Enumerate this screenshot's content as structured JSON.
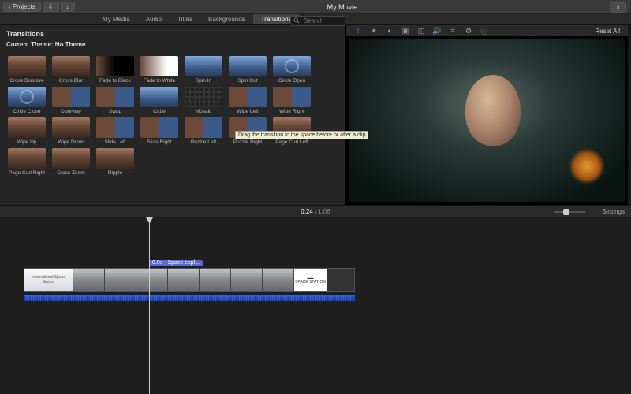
{
  "titlebar": {
    "back": "Projects",
    "title": "My Movie"
  },
  "tabs": [
    "My Media",
    "Audio",
    "Titles",
    "Backgrounds",
    "Transitions"
  ],
  "tabs_active": "Transitions",
  "search": {
    "placeholder": "Search"
  },
  "browser": {
    "heading": "Transitions",
    "theme": "Current Theme: No Theme",
    "items": [
      {
        "label": "Cross Dissolve",
        "cls": ""
      },
      {
        "label": "Cross Blur",
        "cls": ""
      },
      {
        "label": "Fade to Black",
        "cls": "black"
      },
      {
        "label": "Fade to White",
        "cls": "white"
      },
      {
        "label": "Spin In",
        "cls": "blue"
      },
      {
        "label": "Spin Out",
        "cls": "blue"
      },
      {
        "label": "Circle Open",
        "cls": "blue circle"
      },
      {
        "label": "Circle Close",
        "cls": "blue circle"
      },
      {
        "label": "Doorway",
        "cls": "split"
      },
      {
        "label": "Swap",
        "cls": "split"
      },
      {
        "label": "Cube",
        "cls": "blue"
      },
      {
        "label": "Mosaic",
        "cls": "mosaic"
      },
      {
        "label": "Wipe Left",
        "cls": "split"
      },
      {
        "label": "Wipe Right",
        "cls": "split"
      },
      {
        "label": "Wipe Up",
        "cls": ""
      },
      {
        "label": "Wipe Down",
        "cls": ""
      },
      {
        "label": "Slide Left",
        "cls": "split"
      },
      {
        "label": "Slide Right",
        "cls": "split"
      },
      {
        "label": "Puzzle Left",
        "cls": "split"
      },
      {
        "label": "Puzzle Right",
        "cls": "split"
      },
      {
        "label": "Page Curl Left",
        "cls": ""
      },
      {
        "label": "Page Curl Right",
        "cls": ""
      },
      {
        "label": "Cross Zoom",
        "cls": ""
      },
      {
        "label": "Ripple",
        "cls": ""
      }
    ]
  },
  "tooltip": "Drag the transition to the space before or after a clip",
  "preview_toolbar": {
    "icons": [
      "T",
      "wand",
      "swatch",
      "crop",
      "overlay",
      "volume",
      "eq",
      "gear",
      "info"
    ],
    "reset": "Reset All"
  },
  "time": {
    "current": "0:24",
    "sep": " / ",
    "duration": "1:06",
    "settings": "Settings"
  },
  "clip": {
    "label": "8.0s - Space expl...",
    "intro": "International Space Station",
    "outro": "SPACE STATION"
  }
}
